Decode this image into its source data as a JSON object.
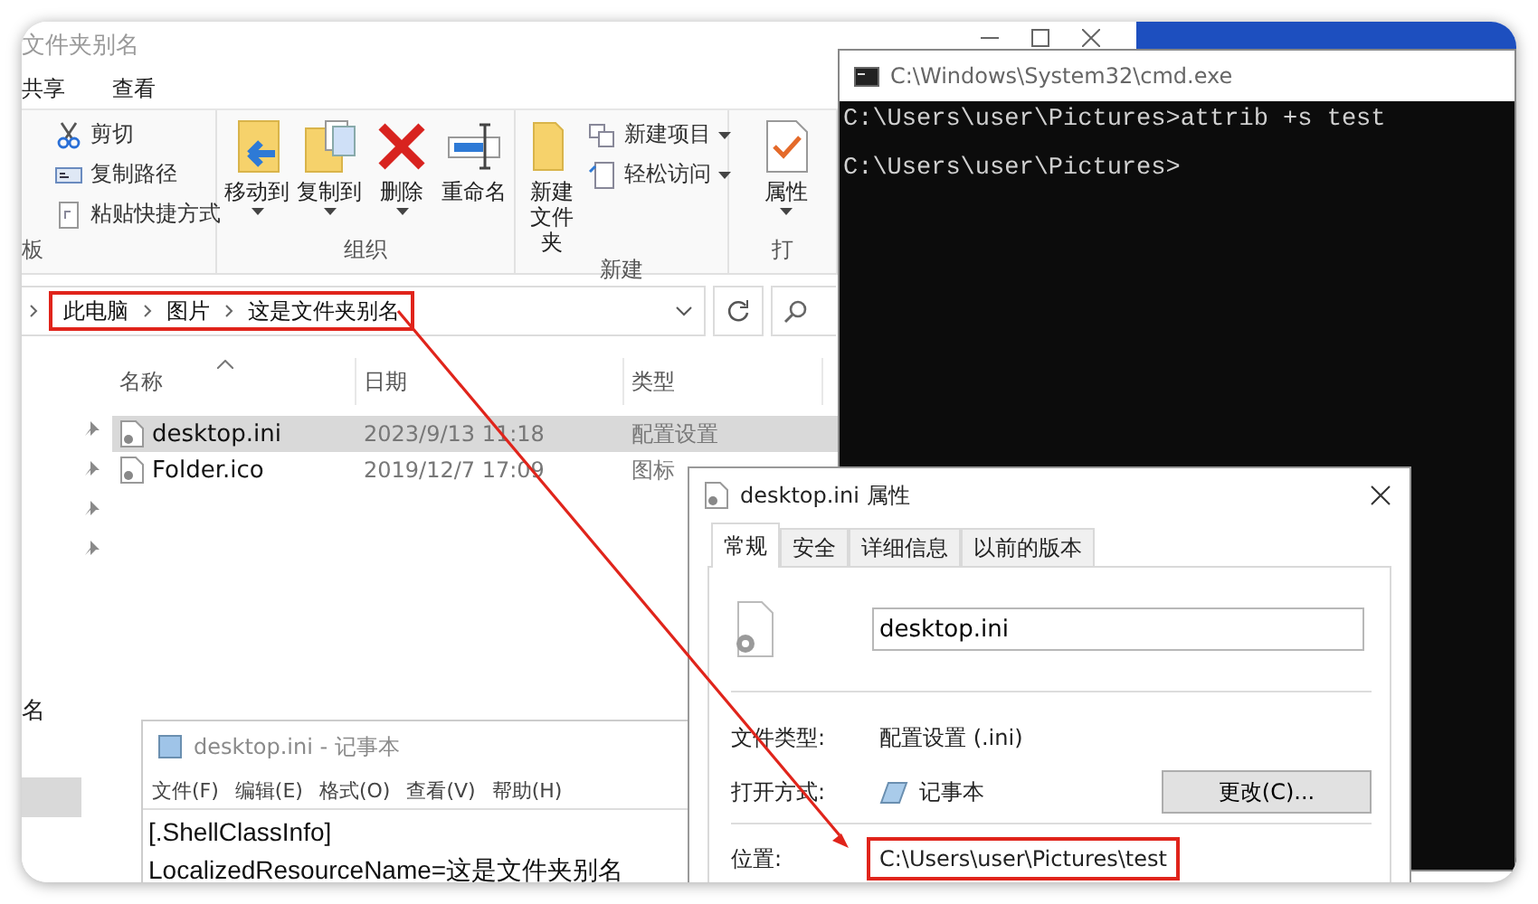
{
  "explorer": {
    "title": "文件夹别名",
    "tabs": [
      "共享",
      "查看"
    ],
    "ribbon": [
      {
        "label": "板",
        "items": [
          {
            "label": "剪切",
            "kind": "small",
            "dropdown": false
          },
          {
            "label": "复制路径",
            "kind": "small",
            "dropdown": false
          },
          {
            "label": "粘贴快捷方式",
            "kind": "small",
            "dropdown": false
          }
        ]
      },
      {
        "label": "组织",
        "items": [
          {
            "label": "移动到",
            "kind": "large",
            "dropdown": true
          },
          {
            "label": "复制到",
            "kind": "large",
            "dropdown": true
          },
          {
            "label": "删除",
            "kind": "large",
            "dropdown": true
          },
          {
            "label": "重命名",
            "kind": "large",
            "dropdown": false
          }
        ]
      },
      {
        "label": "新建",
        "items": [
          {
            "label": "新建文件夹",
            "kind": "large",
            "dropdown": false
          },
          {
            "label": "新建项目",
            "kind": "small",
            "dropdown": true
          },
          {
            "label": "轻松访问",
            "kind": "small",
            "dropdown": true
          }
        ]
      },
      {
        "label": "打",
        "items": [
          {
            "label": "属性",
            "kind": "large",
            "dropdown": true
          }
        ]
      }
    ],
    "address": {
      "crumbs": [
        "此电脑",
        "图片",
        "这是文件夹别名"
      ],
      "highlighted": true
    },
    "columns": [
      {
        "label": "名称",
        "sorted": true
      },
      {
        "label": "日期",
        "sorted": false
      },
      {
        "label": "类型",
        "sorted": false
      }
    ],
    "rows": [
      {
        "name": "desktop.ini",
        "date": "2023/9/13 11:18",
        "type": "配置设置",
        "selected": true
      },
      {
        "name": "Folder.ico",
        "date": "2019/12/7 17:09",
        "type": "图标",
        "selected": false
      }
    ],
    "nav_items": [
      {
        "label": "名",
        "selected": false
      },
      {
        "selected": true
      }
    ]
  },
  "cmd": {
    "title": "C:\\Windows\\System32\\cmd.exe",
    "lines": [
      "C:\\Users\\user\\Pictures>attrib +s test",
      "C:\\Users\\user\\Pictures>"
    ]
  },
  "properties": {
    "title": "desktop.ini 属性",
    "tabs": [
      {
        "label": "常规",
        "selected": true
      },
      {
        "label": "安全",
        "selected": false
      },
      {
        "label": "详细信息",
        "selected": false
      },
      {
        "label": "以前的版本",
        "selected": false
      }
    ],
    "file_name": "desktop.ini",
    "fields": [
      {
        "label": "文件类型:",
        "value": "配置设置 (.ini)",
        "highlighted": false
      },
      {
        "label": "打开方式:",
        "value": "记事本",
        "button": "更改(C)...",
        "highlighted": false
      },
      {
        "label": "位置:",
        "value": "C:\\Users\\user\\Pictures\\test",
        "highlighted": true
      }
    ]
  },
  "notepad": {
    "title": "desktop.ini - 记事本",
    "menu": [
      "文件(F)",
      "编辑(E)",
      "格式(O)",
      "查看(V)",
      "帮助(H)"
    ],
    "lines": [
      "[.ShellClassInfo]",
      "LocalizedResourceName=这是文件夹别名"
    ]
  },
  "annotations": [
    {
      "kind": "arrow"
    }
  ]
}
